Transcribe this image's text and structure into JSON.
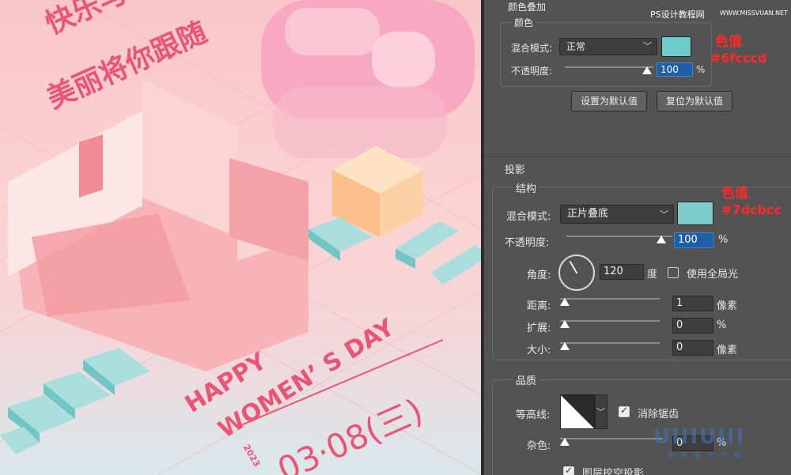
{
  "poster": {
    "line1": "快乐与你",
    "line2": "美丽将你跟随",
    "happy": "HAPPY",
    "womens": "WOMEN’ S DAY",
    "date": "03·08(三)",
    "year": "2023"
  },
  "watermark_top": "PS设计教程网",
  "watermark_url": "WWW.MISSVUAN.NET",
  "color_overlay": {
    "section_title": "颜色叠加",
    "group_title": "颜色",
    "blend_label": "混合模式:",
    "blend_value": "正常",
    "opacity_label": "不透明度:",
    "opacity_value": "100",
    "percent": "%",
    "swatch_color": "#6fcccd",
    "set_default_btn": "设置为默认值",
    "reset_default_btn": "复位为默认值",
    "annot_title": "色值",
    "annot_value": "#6fcccd"
  },
  "drop_shadow": {
    "section_title": "投影",
    "group_title": "结构",
    "blend_label": "混合模式:",
    "blend_value": "正片叠底",
    "opacity_label": "不透明度:",
    "opacity_value": "100",
    "percent": "%",
    "swatch_color": "#7dcbcc",
    "angle_label": "角度:",
    "angle_value": "120",
    "angle_unit": "度",
    "global_light_label": "使用全局光",
    "distance_label": "距离:",
    "distance_value": "1",
    "spread_label": "扩展:",
    "spread_value": "0",
    "size_label": "大小:",
    "size_value": "0",
    "px_unit": "像素",
    "annot_title": "色值",
    "annot_value": "#7dcbcc"
  },
  "quality": {
    "group_title": "品质",
    "contour_label": "等高线:",
    "antialias_label": "消除锯齿",
    "noise_label": "杂色:",
    "noise_value": "0",
    "percent": "%",
    "knockout_label": "图层挖空投影"
  },
  "brand_logo": "UIIIUIII",
  "brand_sub": "优 设 看 文 作 网"
}
